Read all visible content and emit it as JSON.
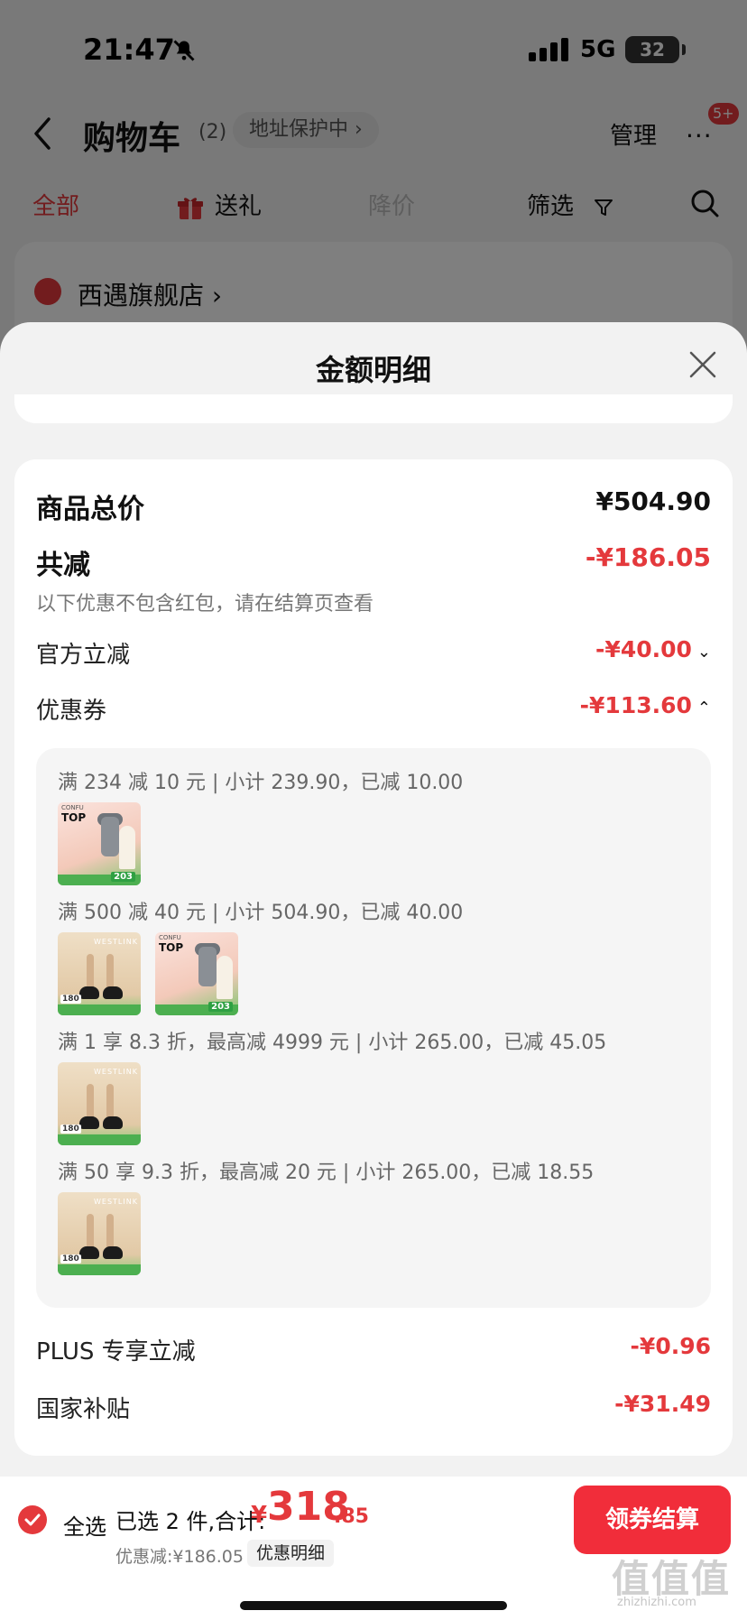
{
  "status_bar": {
    "time": "21:47",
    "network": "5G",
    "battery": "32"
  },
  "nav": {
    "title": "购物车",
    "count": "(2)",
    "address_protect": "地址保护中 ›",
    "manage": "管理",
    "more": "···",
    "badge": "5+"
  },
  "tabs": {
    "all": "全部",
    "gift": "送礼",
    "price_drop": "降价",
    "filter": "筛选"
  },
  "store": {
    "name": "西遇旗舰店 ›"
  },
  "sheet": {
    "title": "金额明细",
    "total_label": "商品总价",
    "total_value": "¥504.90",
    "reduce_label": "共减",
    "reduce_value": "-¥186.05",
    "reduce_note": "以下优惠不包含红包，请在结算页查看",
    "official_label": "官方立减",
    "official_value": "-¥40.00",
    "coupon_label": "优惠券",
    "coupon_value": "-¥113.60",
    "coupons": [
      {
        "text": "满 234 减 10 元 | 小计 239.90，已减 10.00"
      },
      {
        "text": "满 500 减 40 元 | 小计 504.90，已减 40.00"
      },
      {
        "text": "满 1 享 8.3 折，最高减 4999 元 | 小计 265.00，已减 45.05"
      },
      {
        "text": "满 50 享 9.3 折，最高减 20 元 | 小计 265.00，已减 18.55"
      }
    ],
    "thumb_text": {
      "top": "TOP",
      "dryer_price": "203",
      "brand": "CONFU",
      "westlink": "WESTLINK",
      "shoe_tag": "180"
    },
    "plus_label": "PLUS 专享立减",
    "plus_value": "-¥0.96",
    "subsidy_label": "国家补贴",
    "subsidy_value": "-¥31.49"
  },
  "bottom": {
    "select_all": "全选",
    "selected": "已选 2 件,合计:",
    "yen": "¥",
    "total_int": "318",
    "total_dec": ".85",
    "discount": "优惠减:¥186.05",
    "detail": "优惠明细",
    "checkout": "领券结算"
  },
  "watermark": {
    "main": "值值值",
    "sub": "zhizhizhi.com"
  },
  "colors": {
    "accent": "#e4393c",
    "button": "#f12d3a",
    "sheet_bg": "#f2f2f2"
  }
}
